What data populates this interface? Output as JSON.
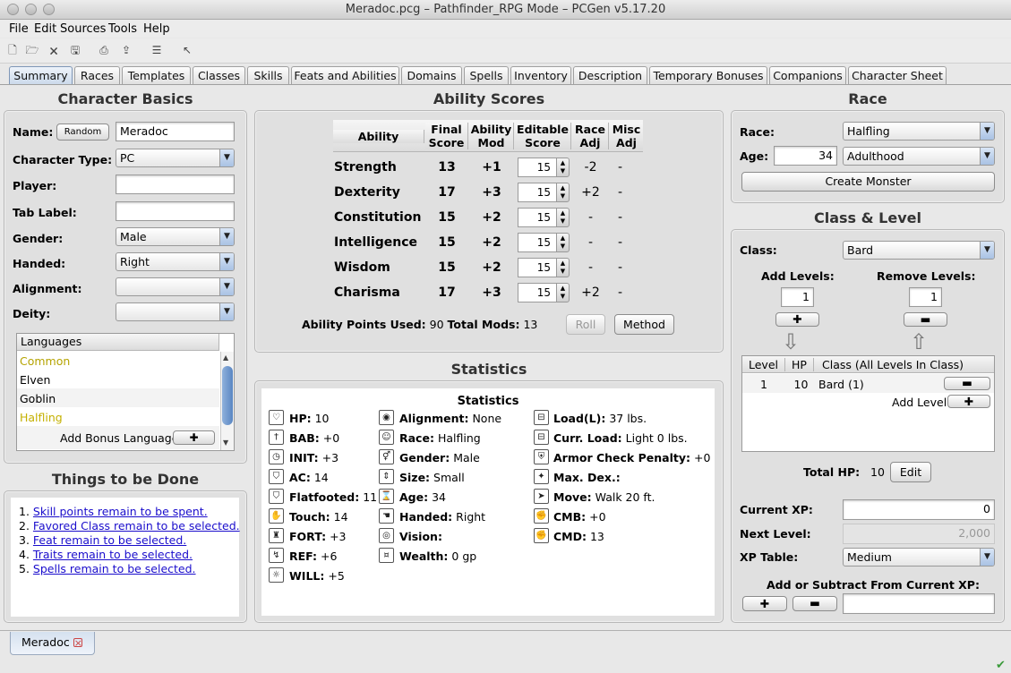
{
  "window": {
    "title": "Meradoc.pcg – Pathfinder_RPG Mode – PCGen v5.17.20"
  },
  "menu": [
    "File",
    "Edit",
    "Sources",
    "Tools",
    "Help"
  ],
  "toolbar_icons": [
    "new-icon",
    "open-icon",
    "close-icon",
    "save-icon",
    "print-icon",
    "export-icon",
    "preferences-icon",
    "pointer-icon"
  ],
  "tabs": [
    "Summary",
    "Races",
    "Templates",
    "Classes",
    "Skills",
    "Feats and Abilities",
    "Domains",
    "Spells",
    "Inventory",
    "Description",
    "Temporary Bonuses",
    "Companions",
    "Character Sheet"
  ],
  "basics": {
    "heading": "Character Basics",
    "name_label": "Name:",
    "random_btn": "Random",
    "name_value": "Meradoc",
    "type_label": "Character Type:",
    "type_value": "PC",
    "player_label": "Player:",
    "player_value": "",
    "tablabel_label": "Tab Label:",
    "tablabel_value": "",
    "gender_label": "Gender:",
    "gender_value": "Male",
    "handed_label": "Handed:",
    "handed_value": "Right",
    "alignment_label": "Alignment:",
    "alignment_value": "",
    "deity_label": "Deity:",
    "deity_value": "",
    "languages_header": "Languages",
    "languages": [
      {
        "name": "Common",
        "color": "#b5a300"
      },
      {
        "name": "Elven",
        "color": "#000000"
      },
      {
        "name": "Goblin",
        "color": "#000000"
      },
      {
        "name": "Halfling",
        "color": "#c4b000"
      }
    ],
    "add_bonus_language": "Add Bonus Language"
  },
  "todo": {
    "heading": "Things to be Done",
    "items": [
      {
        "num": "1.",
        "text": "Skill points remain to be spent."
      },
      {
        "num": "2.",
        "text": "Favored Class remain to be selected."
      },
      {
        "num": "3.",
        "text": "Feat remain to be selected."
      },
      {
        "num": "4.",
        "text": "Traits remain to be selected."
      },
      {
        "num": "5.",
        "text": "Spells remain to be selected."
      }
    ]
  },
  "abilities": {
    "heading": "Ability Scores",
    "headers": {
      "ability": "Ability",
      "final1": "Final",
      "final2": "Score",
      "mod1": "Ability",
      "mod2": "Mod",
      "edit1": "Editable",
      "edit2": "Score",
      "race1": "Race",
      "race2": "Adj",
      "misc1": "Misc",
      "misc2": "Adj"
    },
    "rows": [
      {
        "name": "Strength",
        "final": "13",
        "mod": "+1",
        "edit": "15",
        "race": "-2",
        "misc": "-"
      },
      {
        "name": "Dexterity",
        "final": "17",
        "mod": "+3",
        "edit": "15",
        "race": "+2",
        "misc": "-"
      },
      {
        "name": "Constitution",
        "final": "15",
        "mod": "+2",
        "edit": "15",
        "race": "-",
        "misc": "-"
      },
      {
        "name": "Intelligence",
        "final": "15",
        "mod": "+2",
        "edit": "15",
        "race": "-",
        "misc": "-"
      },
      {
        "name": "Wisdom",
        "final": "15",
        "mod": "+2",
        "edit": "15",
        "race": "-",
        "misc": "-"
      },
      {
        "name": "Charisma",
        "final": "17",
        "mod": "+3",
        "edit": "15",
        "race": "+2",
        "misc": "-"
      }
    ],
    "points_label": "Ability Points Used:",
    "points_value": "90",
    "mods_label": "Total Mods:",
    "mods_value": "13",
    "roll_btn": "Roll",
    "method_btn": "Method"
  },
  "statistics": {
    "heading": "Statistics",
    "inner_title": "Statistics",
    "col1": [
      {
        "icon": "heart-icon",
        "label": "HP:",
        "value": "10"
      },
      {
        "icon": "sword-icon",
        "label": "BAB:",
        "value": "+0"
      },
      {
        "icon": "clock-icon",
        "label": "INIT:",
        "value": "+3"
      },
      {
        "icon": "shield-icon",
        "label": "AC:",
        "value": "14"
      },
      {
        "icon": "shield-flat-icon",
        "label": "Flatfooted:",
        "value": "11"
      },
      {
        "icon": "hand-icon",
        "label": "Touch:",
        "value": "14"
      },
      {
        "icon": "tower-icon",
        "label": "FORT:",
        "value": "+3"
      },
      {
        "icon": "reflex-icon",
        "label": "REF:",
        "value": "+6"
      },
      {
        "icon": "bulb-icon",
        "label": "WILL:",
        "value": "+5"
      }
    ],
    "col2": [
      {
        "icon": "eye-icon",
        "label": "Alignment:",
        "value": "None"
      },
      {
        "icon": "person-icon",
        "label": "Race:",
        "value": " Halfling"
      },
      {
        "icon": "gender-icon",
        "label": "Gender:",
        "value": "Male"
      },
      {
        "icon": "size-icon",
        "label": "Size:",
        "value": "Small"
      },
      {
        "icon": "age-icon",
        "label": "Age:",
        "value": "34"
      },
      {
        "icon": "handed-icon",
        "label": "Handed:",
        "value": "Right"
      },
      {
        "icon": "vision-icon",
        "label": "Vision:",
        "value": ""
      },
      {
        "icon": "wealth-icon",
        "label": "Wealth:",
        "value": "0 gp"
      }
    ],
    "col3": [
      {
        "icon": "load-icon",
        "label": "Load(L):",
        "value": "37 lbs."
      },
      {
        "icon": "curr-load-icon",
        "label": "Curr. Load:",
        "value": "Light 0 lbs."
      },
      {
        "icon": "armor-icon",
        "label": "Armor Check Penalty:",
        "value": "+0"
      },
      {
        "icon": "maxdex-icon",
        "label": "Max. Dex.:",
        "value": ""
      },
      {
        "icon": "move-icon",
        "label": "Move:",
        "value": "Walk 20 ft."
      },
      {
        "icon": "cmb-icon",
        "label": "CMB:",
        "value": "+0"
      },
      {
        "icon": "cmd-icon",
        "label": "CMD:",
        "value": "13"
      }
    ]
  },
  "race": {
    "heading": "Race",
    "race_label": "Race:",
    "race_value": "Halfling",
    "age_label": "Age:",
    "age_value": "34",
    "age_cat": "Adulthood",
    "create_monster": "Create Monster"
  },
  "class_level": {
    "heading": "Class & Level",
    "class_label": "Class:",
    "class_value": "Bard",
    "add_levels_label": "Add Levels:",
    "add_levels_value": "1",
    "remove_levels_label": "Remove Levels:",
    "remove_levels_value": "1",
    "table_headers": [
      "Level",
      "HP",
      "Class (All Levels In Class)"
    ],
    "rows": [
      {
        "level": "1",
        "hp": "10",
        "cls": "Bard (1)"
      }
    ],
    "add_level": "Add Level",
    "total_hp_label": "Total HP:",
    "total_hp_value": "10",
    "edit_btn": "Edit",
    "current_xp_label": "Current XP:",
    "current_xp_value": "0",
    "next_level_label": "Next Level:",
    "next_level_value": "2,000",
    "xp_table_label": "XP Table:",
    "xp_table_value": "Medium",
    "add_sub_label": "Add or Subtract From Current XP:",
    "add_sub_value": ""
  },
  "bottom": {
    "character_tab": "Meradoc"
  }
}
